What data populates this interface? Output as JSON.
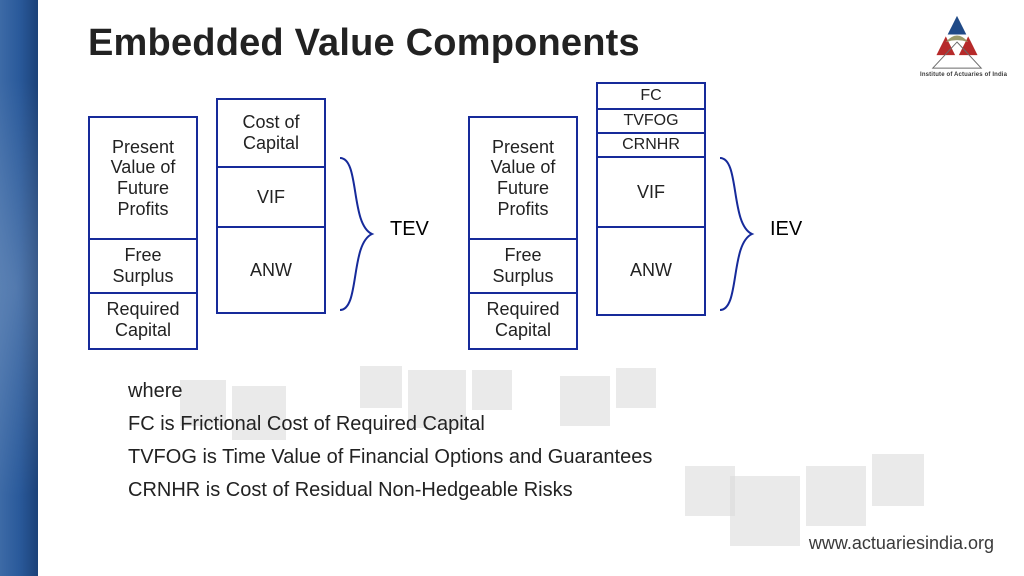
{
  "title": "Embedded Value Components",
  "logo": {
    "caption": "Institute of Actuaries of India"
  },
  "diagram": {
    "leftGroup": {
      "colA": {
        "r1": "Present Value of Future Profits",
        "r2": "Free Surplus",
        "r3": "Required Capital"
      },
      "colB": {
        "r1": "Cost of Capital",
        "r2": "VIF",
        "r3": "ANW"
      },
      "label": "TEV"
    },
    "rightGroup": {
      "colC": {
        "r1": "Present Value of Future Profits",
        "r2": "Free Surplus",
        "r3": "Required Capital"
      },
      "colD": {
        "r1": "FC",
        "r2": "TVFOG",
        "r3": "CRNHR",
        "r4": "VIF",
        "r5": "ANW"
      },
      "label": "IEV"
    }
  },
  "legend": {
    "where": "where",
    "fc": "FC is Frictional Cost of Required Capital",
    "tvfog": "TVFOG is Time Value of Financial Options and Guarantees",
    "crnhr": "CRNHR is Cost of Residual Non-Hedgeable Risks"
  },
  "footerUrl": "www.actuariesindia.org"
}
